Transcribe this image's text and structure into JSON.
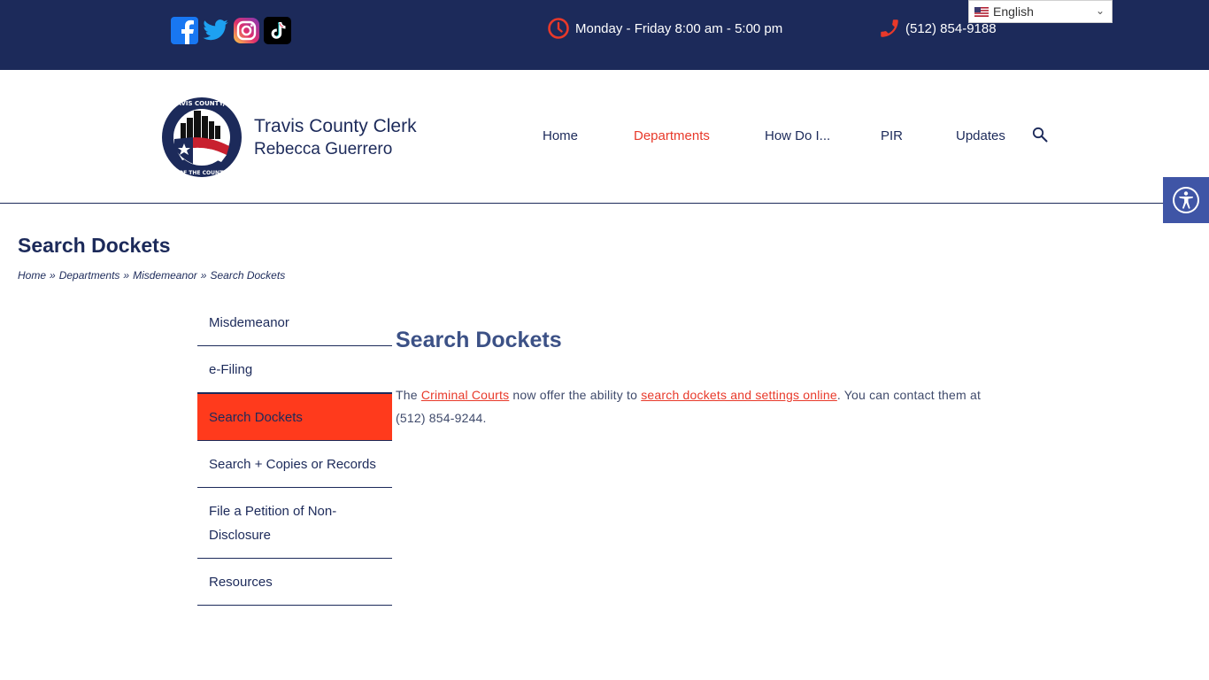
{
  "topbar": {
    "social": [
      {
        "name": "facebook-icon",
        "color": "#1877f2"
      },
      {
        "name": "twitter-icon",
        "color": "#1da1f2"
      },
      {
        "name": "instagram-icon",
        "color": "#d6249f"
      },
      {
        "name": "tiktok-icon",
        "color": "#000000"
      }
    ],
    "hours": "Monday - Friday 8:00 am - 5:00 pm",
    "phone": "(512) 854-9188",
    "language": "English"
  },
  "header": {
    "title": "Travis County Clerk",
    "subtitle": "Rebecca Guerrero",
    "logo_text": "TRAVIS COUNTY, TX · OFFICE OF THE COUNTY CLERK"
  },
  "nav": {
    "items": [
      {
        "label": "Home"
      },
      {
        "label": "Departments"
      },
      {
        "label": "How Do I..."
      },
      {
        "label": "PIR"
      },
      {
        "label": "Updates"
      }
    ]
  },
  "page": {
    "title": "Search Dockets",
    "breadcrumb": [
      "Home",
      "Departments",
      "Misdemeanor",
      "Search Dockets"
    ],
    "separator": "»"
  },
  "sidebar": {
    "items": [
      {
        "label": "Misdemeanor"
      },
      {
        "label": "e-Filing"
      },
      {
        "label": "Search Dockets"
      },
      {
        "label": "Search + Copies or Records"
      },
      {
        "label": "File a Petition of Non-Disclosure"
      },
      {
        "label": "Resources"
      }
    ]
  },
  "main": {
    "title": "Search Dockets",
    "text_1": "The ",
    "link_1": "Criminal Courts",
    "text_2": " now offer the ability to ",
    "link_2": "search dockets and settings online",
    "text_3": ". You can contact them at (512) 854-9244."
  },
  "colors": {
    "navy": "#1c2a5a",
    "accent": "#e8392a",
    "active_bg": "#ff3a1c",
    "a11y": "#3f55a6"
  }
}
